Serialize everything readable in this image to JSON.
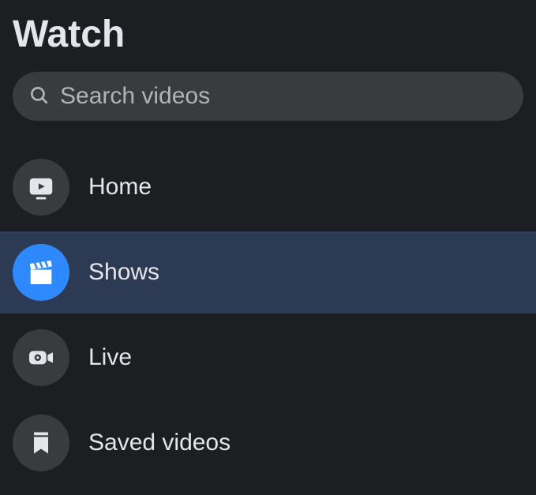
{
  "page_title": "Watch",
  "search": {
    "placeholder": "Search videos",
    "value": ""
  },
  "nav": {
    "items": [
      {
        "label": "Home",
        "icon": "tv-play-icon",
        "active": false
      },
      {
        "label": "Shows",
        "icon": "clapper-icon",
        "active": true
      },
      {
        "label": "Live",
        "icon": "live-camera-icon",
        "active": false
      },
      {
        "label": "Saved videos",
        "icon": "bookmark-icon",
        "active": false
      }
    ]
  },
  "colors": {
    "background": "#1c1e21",
    "surface": "#3a3b3c",
    "active_bg": "#2d3a53",
    "accent": "#2e89ff",
    "text": "#e4e6eb",
    "text_muted": "#b0b3b8"
  }
}
